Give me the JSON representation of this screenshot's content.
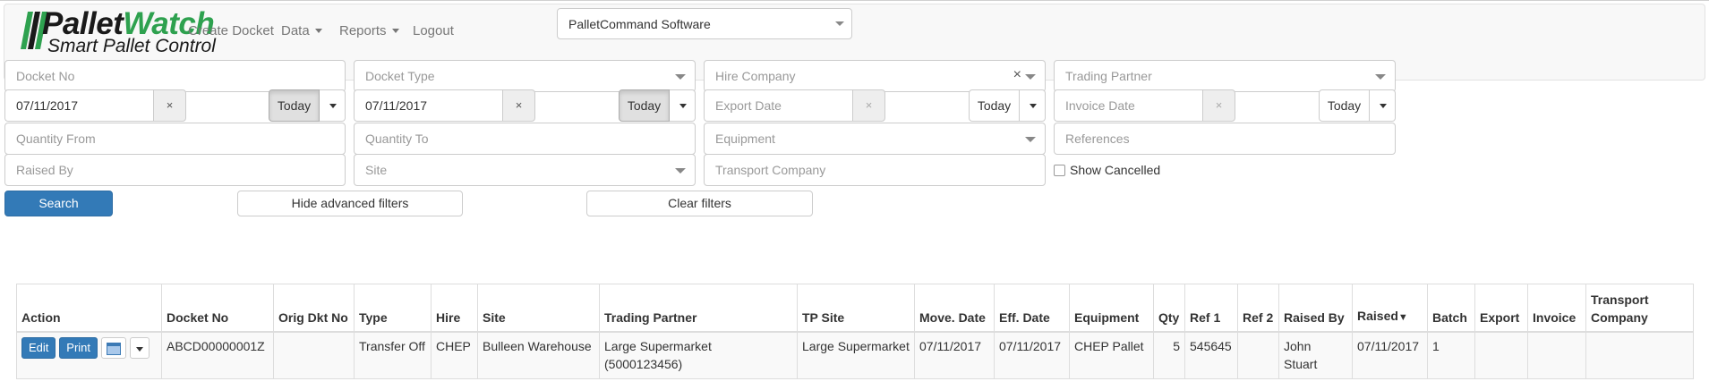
{
  "brand": {
    "title_part1": "Pallet",
    "title_part2": "Watch",
    "subtitle": "Smart Pallet Control"
  },
  "nav": {
    "create_docket": "Create Docket",
    "data": "Data",
    "reports": "Reports",
    "logout": "Logout",
    "company_selected": "PalletCommand Software"
  },
  "filters": {
    "docket_no_placeholder": "Docket No",
    "docket_type_placeholder": "Docket Type",
    "hire_company_placeholder": "Hire Company",
    "trading_partner_placeholder": "Trading Partner",
    "move_date_value": "07/11/2017",
    "eff_date_value": "07/11/2017",
    "export_date_placeholder": "Export Date",
    "invoice_date_placeholder": "Invoice Date",
    "clear_glyph": "×",
    "today_label": "Today",
    "quantity_from_placeholder": "Quantity From",
    "quantity_to_placeholder": "Quantity To",
    "equipment_placeholder": "Equipment",
    "references_placeholder": "References",
    "raised_by_placeholder": "Raised By",
    "site_placeholder": "Site",
    "transport_company_placeholder": "Transport Company",
    "show_cancelled_label": "Show Cancelled",
    "search_button": "Search",
    "hide_advanced_button": "Hide advanced filters",
    "clear_filters_button": "Clear filters"
  },
  "table": {
    "headers": {
      "action": "Action",
      "docket_no": "Docket No",
      "orig_dkt_no": "Orig Dkt No",
      "type": "Type",
      "hire": "Hire",
      "site": "Site",
      "trading_partner": "Trading Partner",
      "tp_site": "TP Site",
      "move_date": "Move. Date",
      "eff_date": "Eff. Date",
      "equipment": "Equipment",
      "qty": "Qty",
      "ref1": "Ref 1",
      "ref2": "Ref 2",
      "raised_by": "Raised By",
      "raised": "Raised",
      "raised_sort": "▼",
      "batch": "Batch",
      "export": "Export",
      "invoice": "Invoice",
      "transport_company": "Transport Company"
    },
    "row_actions": {
      "edit": "Edit",
      "print": "Print"
    },
    "rows": [
      {
        "docket_no": "ABCD00000001Z",
        "orig_dkt_no": "",
        "type": "Transfer Off",
        "hire": "CHEP",
        "site": "Bulleen Warehouse",
        "trading_partner": "Large Supermarket (5000123456)",
        "tp_site": "Large Supermarket",
        "move_date": "07/11/2017",
        "eff_date": "07/11/2017",
        "equipment": "CHEP Pallet",
        "qty": "5",
        "ref1": "545645",
        "ref2": "",
        "raised_by": "John Stuart",
        "raised": "07/11/2017",
        "batch": "1",
        "export": "",
        "invoice": "",
        "transport_company": ""
      }
    ]
  },
  "colors": {
    "primary": "#337ab7",
    "brand_green": "#2ea14f"
  }
}
